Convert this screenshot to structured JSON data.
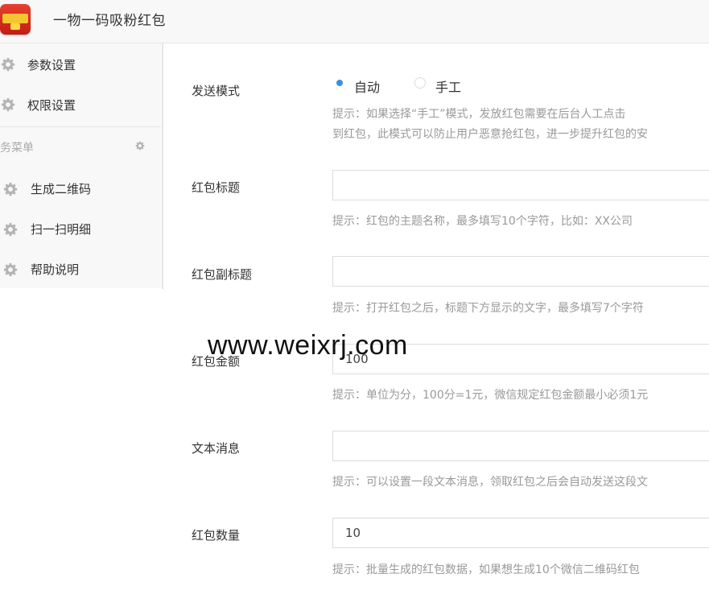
{
  "app": {
    "title": "一物一码吸粉红包"
  },
  "sidebar": {
    "items": [
      {
        "label": "参数设置"
      },
      {
        "label": "权限设置"
      }
    ],
    "section_title": "务菜单",
    "section_items": [
      {
        "label": "生成二维码"
      },
      {
        "label": "扫一扫明细"
      },
      {
        "label": "帮助说明"
      }
    ]
  },
  "form": {
    "send_mode": {
      "label": "发送模式",
      "options": [
        {
          "label": "自动",
          "selected": true
        },
        {
          "label": "手工",
          "selected": false
        }
      ],
      "hint_line1": "提示：如果选择“手工”模式，发放红包需要在后台人工点击",
      "hint_line2": "到红包，此模式可以防止用户恶意抢红包，进一步提升红包的安"
    },
    "title": {
      "label": "红包标题",
      "value": "",
      "hint": "提示：红包的主题名称，最多填写10个字符，比如：XX公司"
    },
    "subtitle": {
      "label": "红包副标题",
      "value": "",
      "hint": "提示：打开红包之后，标题下方显示的文字，最多填写7个字符"
    },
    "amount": {
      "label": "红包金额",
      "value": "100",
      "hint": "提示：单位为分，100分=1元，微信规定红包金额最小必须1元"
    },
    "text_message": {
      "label": "文本消息",
      "value": "",
      "hint": "提示：可以设置一段文本消息，领取红包之后会自动发送这段文"
    },
    "count": {
      "label": "红包数量",
      "value": "10",
      "hint": "提示：批量生成的红包数据，如果想生成10个微信二维码红包"
    }
  },
  "watermark": {
    "text": "www.weixrj.com"
  },
  "colors": {
    "radio_accent": "#3a8ee6",
    "logo_red": "#d32f2f",
    "logo_gold": "#f4c431"
  }
}
